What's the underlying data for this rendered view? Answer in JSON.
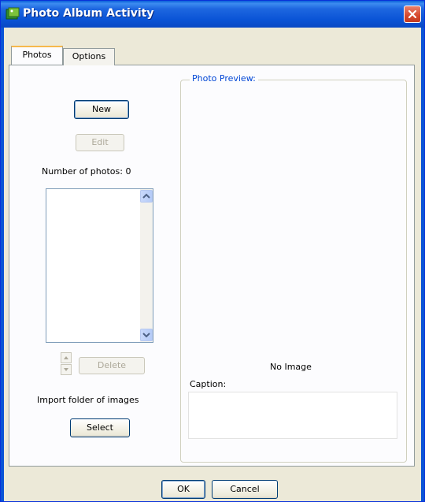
{
  "window": {
    "title": "Photo Album Activity",
    "close_icon": "close-icon"
  },
  "tabs": [
    {
      "label": "Photos",
      "active": true
    },
    {
      "label": "Options",
      "active": false
    }
  ],
  "photos_tab": {
    "new_label": "New",
    "edit_label": "Edit",
    "photo_count_label": "Number of photos: 0",
    "delete_label": "Delete",
    "import_label": "Import folder of images",
    "select_label": "Select"
  },
  "preview": {
    "group_label": "Photo Preview:",
    "no_image_label": "No Image",
    "caption_label": "Caption:",
    "caption_value": ""
  },
  "footer": {
    "ok_label": "OK",
    "cancel_label": "Cancel"
  },
  "colors": {
    "titlebar": "#0a54d6",
    "accent_tab": "#f6b84d",
    "group_label": "#0046d5"
  }
}
